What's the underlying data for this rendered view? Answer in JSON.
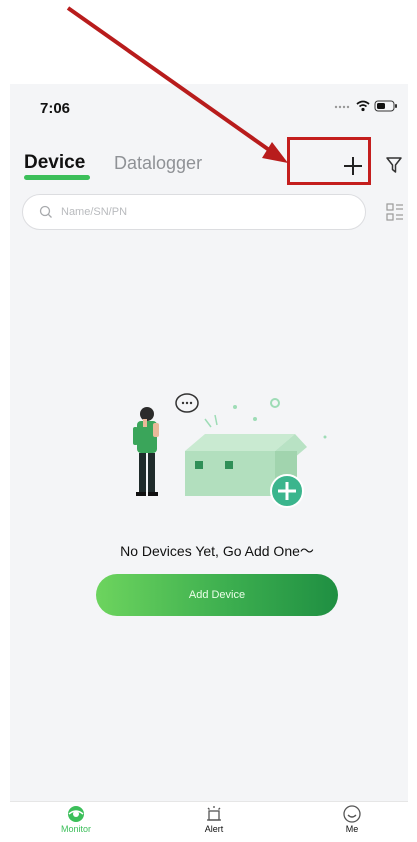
{
  "status_bar": {
    "time": "7:06"
  },
  "header": {
    "tabs": [
      {
        "label": "Device",
        "active": true
      },
      {
        "label": "Datalogger",
        "active": false
      }
    ],
    "add_icon": "plus-icon",
    "filter_icon": "filter-icon"
  },
  "search": {
    "placeholder": "Name/SN/PN",
    "value": ""
  },
  "empty_state": {
    "message": "No Devices Yet, Go Add One～",
    "button_label": "Add Device"
  },
  "bottom_nav": {
    "items": [
      {
        "label": "Monitor",
        "icon": "monitor-icon",
        "active": true
      },
      {
        "label": "Alert",
        "icon": "alert-icon",
        "active": false
      },
      {
        "label": "Me",
        "icon": "me-icon",
        "active": false
      }
    ]
  },
  "colors": {
    "accent": "#3cbf5a",
    "callout": "#c41e1e",
    "inactive_tab": "#8f9296"
  }
}
